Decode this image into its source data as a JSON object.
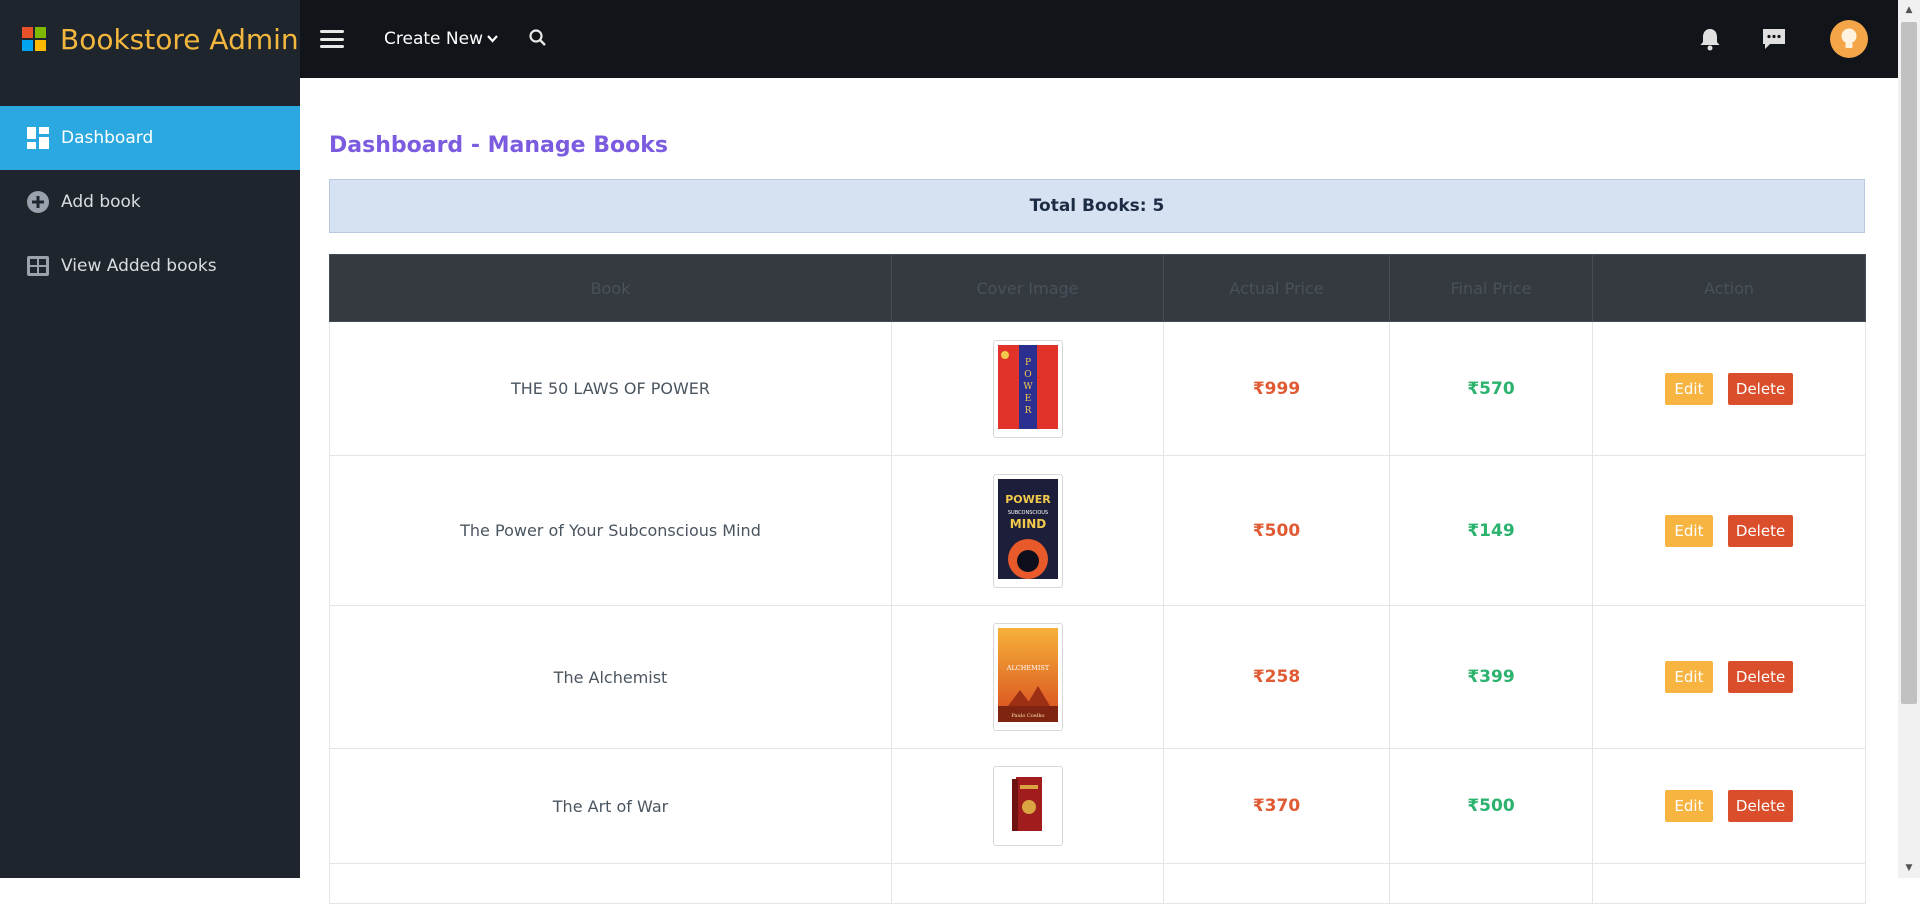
{
  "brand": {
    "title": "Bookstore Admin",
    "logo_colors": [
      "#e8512a",
      "#7fba00",
      "#00a4ef",
      "#ffb900"
    ]
  },
  "sidebar": {
    "items": [
      {
        "label": "Dashboard",
        "icon": "dashboard-icon",
        "active": true
      },
      {
        "label": "Add book",
        "icon": "plus-circle-icon",
        "active": false
      },
      {
        "label": "View Added books",
        "icon": "table-icon",
        "active": false
      }
    ]
  },
  "topbar": {
    "create_new_label": "Create New",
    "icons": [
      "menu-icon",
      "search-icon",
      "bell-icon",
      "chat-icon",
      "avatar"
    ]
  },
  "main": {
    "title": "Dashboard - Manage Books",
    "total_books": "Total Books: 5",
    "table": {
      "headers": [
        "Book",
        "Cover Image",
        "Actual Price",
        "Final Price",
        "Action"
      ],
      "rows": [
        {
          "book": "THE 50 LAWS OF POWER",
          "actual_price": "₹999",
          "final_price": "₹570",
          "edit": "Edit",
          "delete": "Delete"
        },
        {
          "book": "The Power of Your Subconscious Mind",
          "actual_price": "₹500",
          "final_price": "₹149",
          "edit": "Edit",
          "delete": "Delete"
        },
        {
          "book": "The Alchemist",
          "actual_price": "₹258",
          "final_price": "₹399",
          "edit": "Edit",
          "delete": "Delete"
        },
        {
          "book": "The Art of War",
          "actual_price": "₹370",
          "final_price": "₹500",
          "edit": "Edit",
          "delete": "Delete"
        }
      ]
    }
  },
  "colors": {
    "sidebar_bg": "#1f252d",
    "active_nav": "#2ba8e0",
    "brand_accent": "#f4b73e",
    "title_accent": "#7b5ce0",
    "actual_price": "#e05a33",
    "final_price": "#2bb36e",
    "edit_button": "#f8b441",
    "delete_button": "#db4e2c"
  }
}
